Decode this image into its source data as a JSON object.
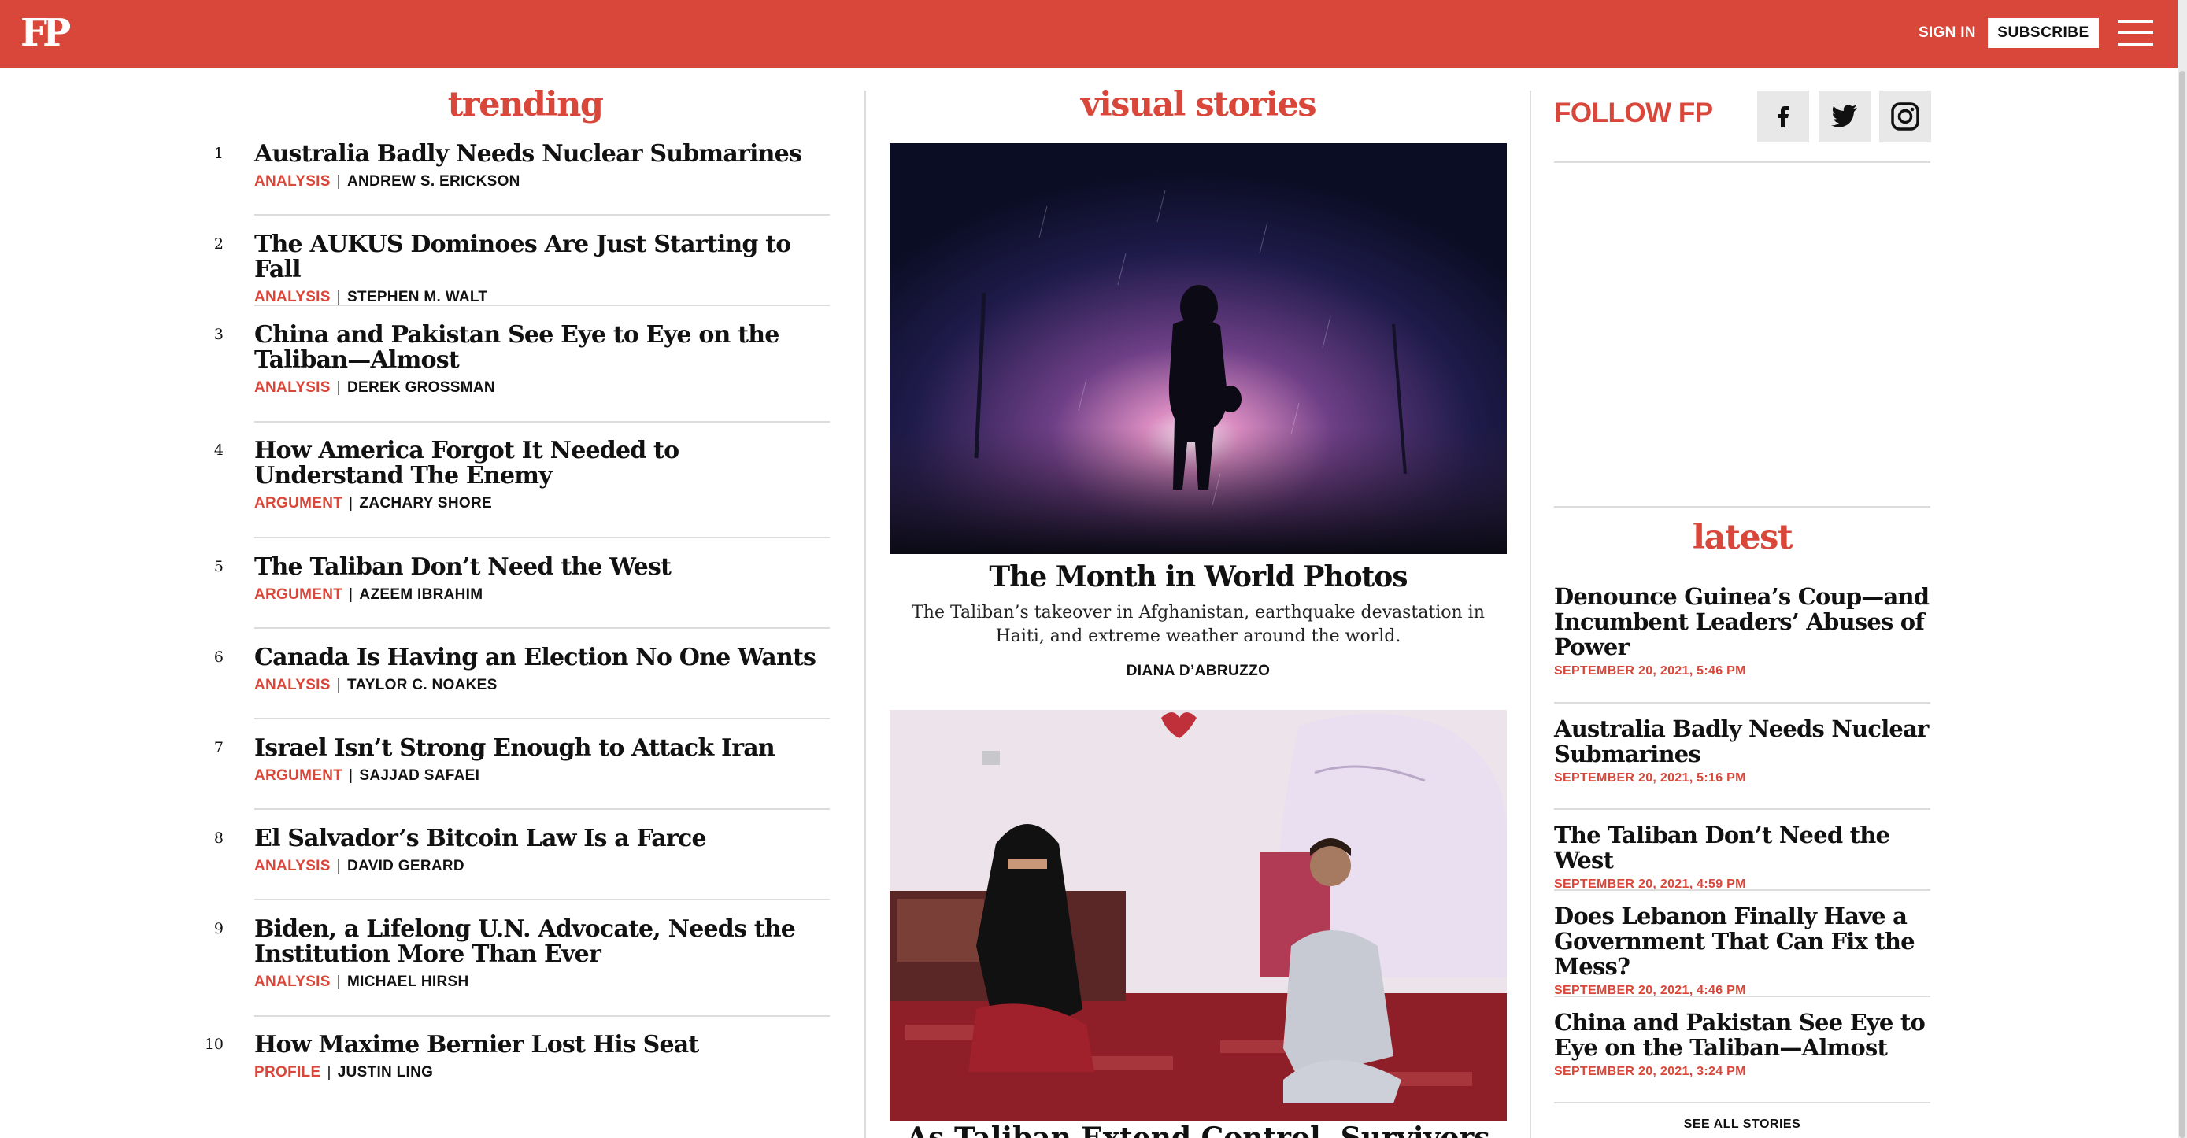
{
  "header": {
    "logo": "FP",
    "sign_in": "SIGN IN",
    "subscribe": "SUBSCRIBE",
    "brand_color": "#d9463a"
  },
  "trending": {
    "title": "trending",
    "items": [
      {
        "num": "1",
        "title": "Australia Badly Needs Nuclear Submarines",
        "category": "ANALYSIS",
        "author": "ANDREW S. ERICKSON"
      },
      {
        "num": "2",
        "title": "The AUKUS Dominoes Are Just Starting to Fall",
        "category": "ANALYSIS",
        "author": "STEPHEN M. WALT"
      },
      {
        "num": "3",
        "title": "China and Pakistan See Eye to Eye on the Taliban—Almost",
        "category": "ANALYSIS",
        "author": "DEREK GROSSMAN"
      },
      {
        "num": "4",
        "title": "How America Forgot It Needed to Understand The Enemy",
        "category": "ARGUMENT",
        "author": "ZACHARY SHORE"
      },
      {
        "num": "5",
        "title": "The Taliban Don’t Need the West",
        "category": "ARGUMENT",
        "author": "AZEEM IBRAHIM"
      },
      {
        "num": "6",
        "title": "Canada Is Having an Election No One Wants",
        "category": "ANALYSIS",
        "author": "TAYLOR C. NOAKES"
      },
      {
        "num": "7",
        "title": "Israel Isn’t Strong Enough to Attack Iran",
        "category": "ARGUMENT",
        "author": "SAJJAD SAFAEI"
      },
      {
        "num": "8",
        "title": "El Salvador’s Bitcoin Law Is a Farce",
        "category": "ANALYSIS",
        "author": "DAVID GERARD"
      },
      {
        "num": "9",
        "title": "Biden, a Lifelong U.N. Advocate, Needs the Institution More Than Ever",
        "category": "ANALYSIS",
        "author": "MICHAEL HIRSH"
      },
      {
        "num": "10",
        "title": "How Maxime Bernier Lost His Seat",
        "category": "PROFILE",
        "author": "JUSTIN LING"
      }
    ]
  },
  "visual_stories": {
    "title": "visual stories",
    "story1": {
      "title": "The Month in World Photos",
      "description": "The Taliban’s takeover in Afghanistan, earthquake devastation in Haiti, and extreme weather around the world.",
      "author": "DIANA D’ABRUZZO"
    },
    "story2_title_partial": "As Taliban Extend Control, Survivors Share"
  },
  "follow": {
    "label": "FOLLOW FP",
    "icons": [
      "facebook-icon",
      "twitter-icon",
      "instagram-icon"
    ]
  },
  "latest": {
    "title": "latest",
    "items": [
      {
        "title": "Denounce Guinea’s Coup—and Incumbent Leaders’ Abuses of Power",
        "date": "SEPTEMBER 20, 2021, 5:46 PM"
      },
      {
        "title": "Australia Badly Needs Nuclear Submarines",
        "date": "SEPTEMBER 20, 2021, 5:16 PM"
      },
      {
        "title": "The Taliban Don’t Need the West",
        "date": "SEPTEMBER 20, 2021, 4:59 PM"
      },
      {
        "title": "Does Lebanon Finally Have a Government That Can Fix the Mess?",
        "date": "SEPTEMBER 20, 2021, 4:46 PM"
      },
      {
        "title": "China and Pakistan See Eye to Eye on the Taliban—Almost",
        "date": "SEPTEMBER 20, 2021, 3:24 PM"
      }
    ],
    "see_all": "SEE ALL STORIES"
  }
}
